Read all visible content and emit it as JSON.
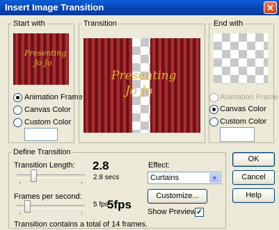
{
  "window": {
    "title": "Insert Image Transition",
    "close_glyph": "✕"
  },
  "start_with": {
    "legend": "Start with",
    "preview_text_line1": "Presenting",
    "preview_text_line2": "Jo Jo",
    "options": [
      "Animation Frame",
      "Canvas Color",
      "Custom Color"
    ],
    "selected": "Animation Frame"
  },
  "transition": {
    "legend": "Transition",
    "preview_text_line1": "Presenting",
    "preview_text_line2": "Jo Jo"
  },
  "end_with": {
    "legend": "End with",
    "options": [
      "Animation Frame",
      "Canvas Color",
      "Custom Color"
    ],
    "selected": "Canvas Color",
    "disabled": [
      "Animation Frame"
    ]
  },
  "define": {
    "legend": "Define Transition",
    "length_label": "Transition Length:",
    "length_value": "2.8 secs",
    "length_big": "2.8",
    "length_fraction": 0.22,
    "fps_label": "Frames per second:",
    "fps_value": "5 fps",
    "fps_big": "5fps",
    "fps_fraction": 0.12,
    "effect_label": "Effect:",
    "effect_value": "Curtains",
    "customize_label": "Customize...",
    "show_preview_label": "Show Preview",
    "show_preview_checked": true,
    "summary": "Transition contains a total of 14 frames."
  },
  "buttons": {
    "ok": "OK",
    "cancel": "Cancel",
    "help": "Help"
  },
  "colors": {
    "title_bar": "#0842b0",
    "curtain": "#8e1e22",
    "script_text": "#e3b23c",
    "face": "#ece9d8"
  }
}
